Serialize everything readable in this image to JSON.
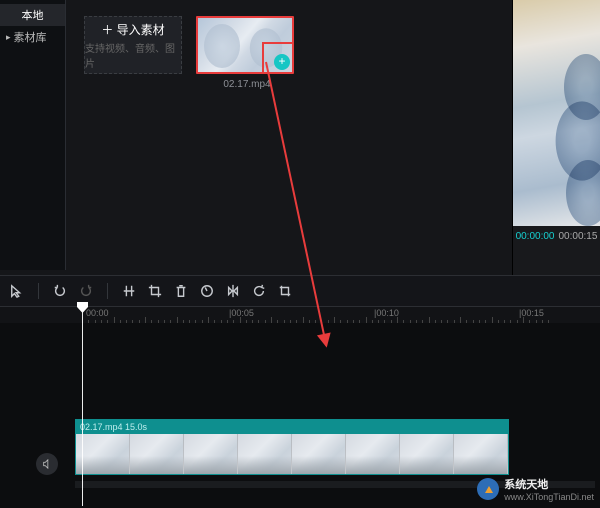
{
  "sidebar": {
    "tab_local": "本地",
    "tab_library": "素材库"
  },
  "import": {
    "label": "＋ 导入素材",
    "hint": "支持视频、音频、图片"
  },
  "media": {
    "clip1_name": "02.17.mp4"
  },
  "preview": {
    "current_time": "00:00:00",
    "duration": "00:00:15"
  },
  "timeline": {
    "clip_header": "02.17.mp4  15.0s",
    "ticks": [
      "00:00",
      "|00:05",
      "|00:10",
      "|00:15"
    ]
  },
  "watermark": {
    "cn": "系统天地",
    "en": "www.XiTongTianDi.net"
  }
}
